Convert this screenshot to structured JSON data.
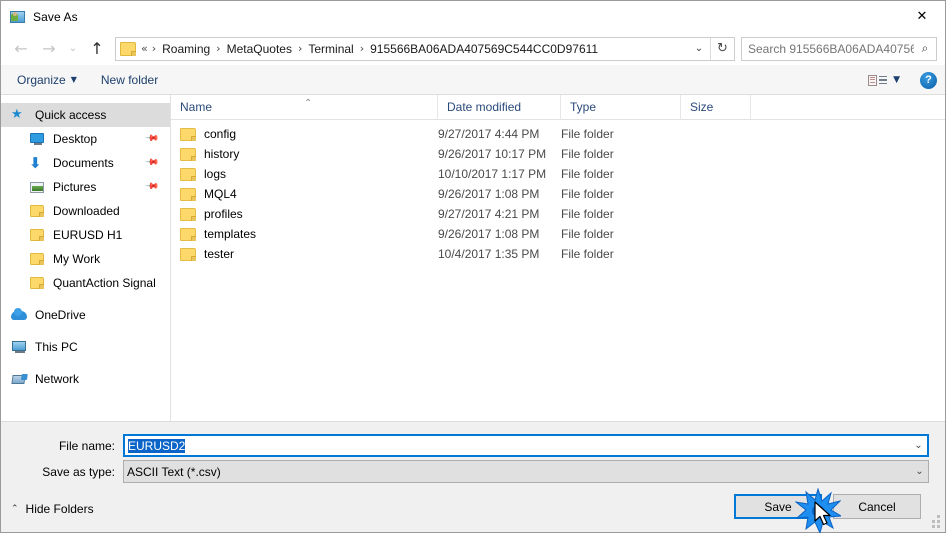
{
  "window": {
    "title": "Save As",
    "app_icon": "save-as-app-icon",
    "close_label": "✕"
  },
  "nav": {
    "back_icon": "arrow-left-icon",
    "forward_icon": "arrow-right-icon",
    "recent_icon": "chevron-down-icon",
    "up_icon": "arrow-up-icon",
    "folder_icon": "folder-icon",
    "breadcrumbs": [
      {
        "label": "«",
        "type": "overflow"
      },
      {
        "label": "Roaming",
        "type": "crumb"
      },
      {
        "label": "MetaQuotes",
        "type": "crumb"
      },
      {
        "label": "Terminal",
        "type": "crumb"
      },
      {
        "label": "915566BA06ADA407569C544CC0D97611",
        "type": "crumb"
      }
    ],
    "separator": "›",
    "dropdown_icon": "chevron-down-icon",
    "refresh_icon": "refresh-icon"
  },
  "search": {
    "placeholder": "Search 915566BA06ADA40756...",
    "value": "",
    "icon": "search-icon"
  },
  "toolbar": {
    "organize_label": "Organize",
    "organize_caret": "▼",
    "new_folder_label": "New folder",
    "view_icon": "view-options-icon",
    "view_caret": "▼",
    "help_label": "?"
  },
  "sidebar": {
    "items": [
      {
        "label": "Quick access",
        "icon": "star-icon",
        "selected": true,
        "indent": false,
        "pinned": false,
        "group": false
      },
      {
        "label": "Desktop",
        "icon": "desktop-icon",
        "selected": false,
        "indent": true,
        "pinned": true,
        "group": false
      },
      {
        "label": "Documents",
        "icon": "download-icon",
        "selected": false,
        "indent": true,
        "pinned": true,
        "group": false
      },
      {
        "label": "Pictures",
        "icon": "pictures-icon",
        "selected": false,
        "indent": true,
        "pinned": true,
        "group": false
      },
      {
        "label": "Downloaded",
        "icon": "folder-icon",
        "selected": false,
        "indent": true,
        "pinned": false,
        "group": false
      },
      {
        "label": "EURUSD H1",
        "icon": "folder-icon",
        "selected": false,
        "indent": true,
        "pinned": false,
        "group": false
      },
      {
        "label": "My Work",
        "icon": "folder-icon",
        "selected": false,
        "indent": true,
        "pinned": false,
        "group": false
      },
      {
        "label": "QuantAction Signal",
        "icon": "folder-icon",
        "selected": false,
        "indent": true,
        "pinned": false,
        "group": false
      },
      {
        "label": "OneDrive",
        "icon": "cloud-icon",
        "selected": false,
        "indent": false,
        "pinned": false,
        "group": true
      },
      {
        "label": "This PC",
        "icon": "computer-icon",
        "selected": false,
        "indent": false,
        "pinned": false,
        "group": true
      },
      {
        "label": "Network",
        "icon": "network-icon",
        "selected": false,
        "indent": false,
        "pinned": false,
        "group": true
      }
    ]
  },
  "filelist": {
    "columns": [
      {
        "label": "Name",
        "sorted": true,
        "sort_mark": "⌃"
      },
      {
        "label": "Date modified",
        "sorted": false,
        "sort_mark": ""
      },
      {
        "label": "Type",
        "sorted": false,
        "sort_mark": ""
      },
      {
        "label": "Size",
        "sorted": false,
        "sort_mark": ""
      }
    ],
    "rows": [
      {
        "name": "config",
        "date": "9/27/2017 4:44 PM",
        "type": "File folder",
        "size": ""
      },
      {
        "name": "history",
        "date": "9/26/2017 10:17 PM",
        "type": "File folder",
        "size": ""
      },
      {
        "name": "logs",
        "date": "10/10/2017 1:17 PM",
        "type": "File folder",
        "size": ""
      },
      {
        "name": "MQL4",
        "date": "9/26/2017 1:08 PM",
        "type": "File folder",
        "size": ""
      },
      {
        "name": "profiles",
        "date": "9/27/2017 4:21 PM",
        "type": "File folder",
        "size": ""
      },
      {
        "name": "templates",
        "date": "9/26/2017 1:08 PM",
        "type": "File folder",
        "size": ""
      },
      {
        "name": "tester",
        "date": "10/4/2017 1:35 PM",
        "type": "File folder",
        "size": ""
      }
    ]
  },
  "form": {
    "file_name_label": "File name:",
    "file_name_value": "EURUSD2",
    "file_name_caret": "⌄",
    "save_type_label": "Save as type:",
    "save_type_value": "ASCII Text (*.csv)",
    "save_type_caret": "⌄"
  },
  "footer": {
    "hide_folders_label": "Hide Folders",
    "hide_folders_caret": "⌃",
    "save_label": "Save",
    "cancel_label": "Cancel"
  },
  "colors": {
    "accent": "#0078d7",
    "selection": "#0b64c8",
    "folder": "#fcd96a",
    "crumb_text": "#1a1a1a",
    "header_text": "#2a4a7a"
  }
}
